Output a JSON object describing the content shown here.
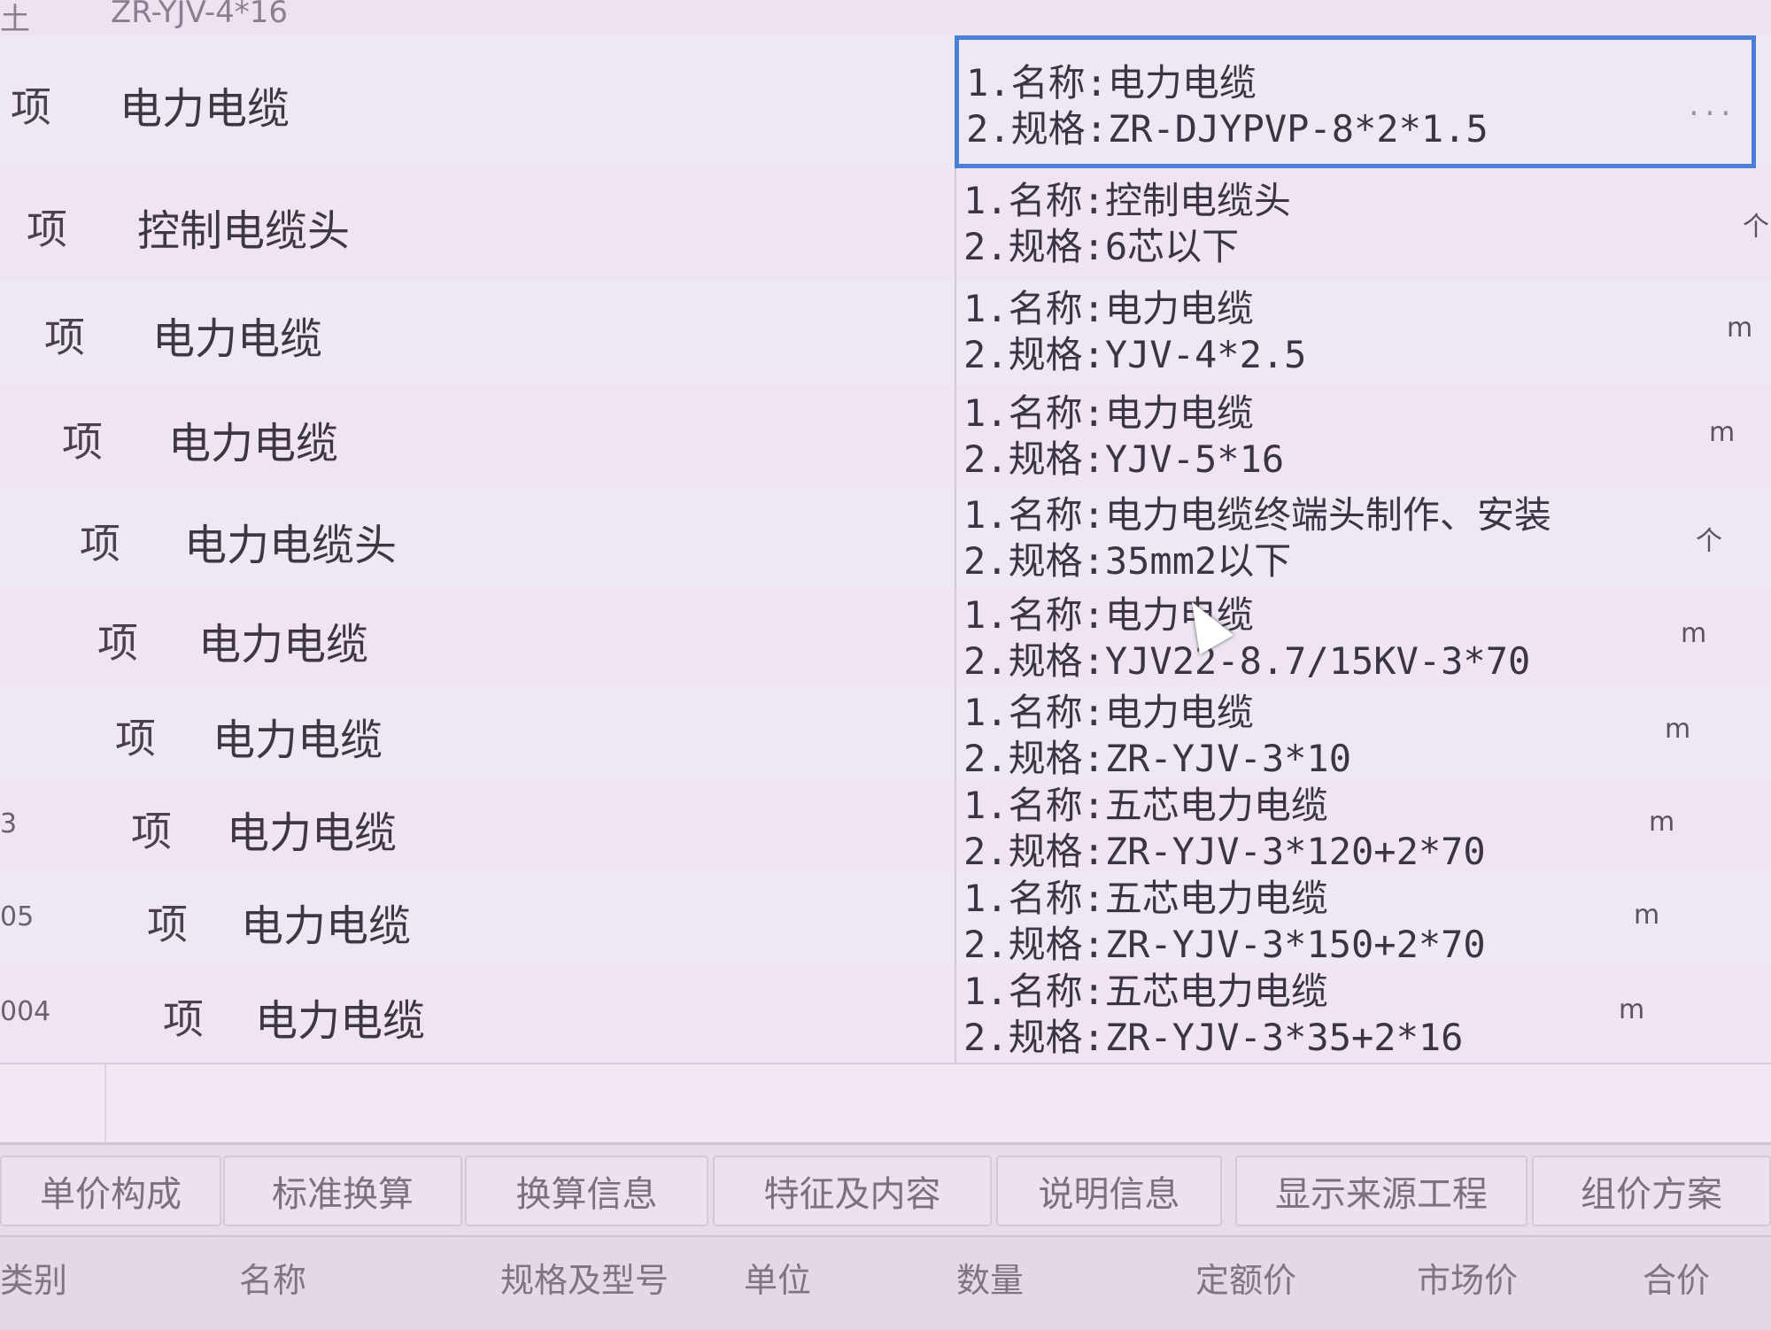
{
  "top_row": {
    "col1": "土",
    "col2": "ZR-YJV-4*16"
  },
  "rows": [
    {
      "code": "",
      "type": "项",
      "name": "电力电缆",
      "feat1": "1.名称:电力电缆",
      "feat2": "2.规格:ZR-DJYPVP-8*2*1.5",
      "unit": "",
      "selected": true,
      "ellipsis": "..."
    },
    {
      "code": "",
      "type": "项",
      "name": "控制电缆头",
      "feat1": "1.名称:控制电缆头",
      "feat2": "2.规格:6芯以下",
      "unit": "个"
    },
    {
      "code": "",
      "type": "项",
      "name": "电力电缆",
      "feat1": "1.名称:电力电缆",
      "feat2": "2.规格:YJV-4*2.5",
      "unit": "m"
    },
    {
      "code": "",
      "type": "项",
      "name": "电力电缆",
      "feat1": "1.名称:电力电缆",
      "feat2": "2.规格:YJV-5*16",
      "unit": "m"
    },
    {
      "code": "",
      "type": "项",
      "name": "电力电缆头",
      "feat1": "1.名称:电力电缆终端头制作、安装",
      "feat2": "2.规格:35mm2以下",
      "unit": "个"
    },
    {
      "code": "",
      "type": "项",
      "name": "电力电缆",
      "feat1": "1.名称:电力电缆",
      "feat2": "2.规格:YJV22-8.7/15KV-3*70",
      "unit": "m"
    },
    {
      "code": "",
      "type": "项",
      "name": "电力电缆",
      "feat1": "1.名称:电力电缆",
      "feat2": "2.规格:ZR-YJV-3*10",
      "unit": "m"
    },
    {
      "code": "3",
      "type": "项",
      "name": "电力电缆",
      "feat1": "1.名称:五芯电力电缆",
      "feat2": "2.规格:ZR-YJV-3*120+2*70",
      "unit": "m"
    },
    {
      "code": "05",
      "type": "项",
      "name": "电力电缆",
      "feat1": "1.名称:五芯电力电缆",
      "feat2": "2.规格:ZR-YJV-3*150+2*70",
      "unit": "m"
    },
    {
      "code": "004",
      "type": "项",
      "name": "电力电缆",
      "feat1": "1.名称:五芯电力电缆",
      "feat2": "2.规格:ZR-YJV-3*35+2*16",
      "unit": "m"
    }
  ],
  "tabs": [
    "单价构成",
    "标准换算",
    "换算信息",
    "特征及内容",
    "说明信息",
    "显示来源工程",
    "组价方案"
  ],
  "sub_headers": [
    "类别",
    "名称",
    "规格及型号",
    "单位",
    "数量",
    "定额价",
    "市场价",
    "合价"
  ]
}
